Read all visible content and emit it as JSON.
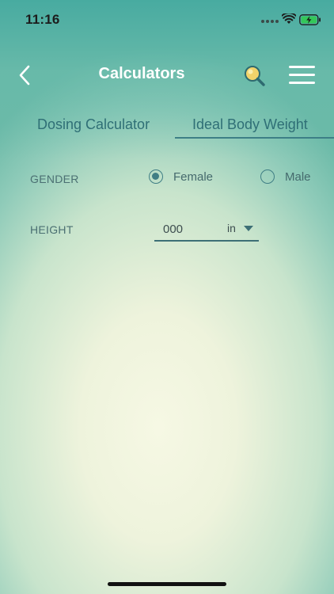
{
  "status_bar": {
    "time": "11:16"
  },
  "nav": {
    "title": "Calculators",
    "back_icon": "chevron-left-icon",
    "search_icon": "search-icon",
    "menu_icon": "hamburger-menu-icon"
  },
  "tabs": [
    {
      "label": "Dosing Calculator",
      "selected": false
    },
    {
      "label": "Ideal Body Weight",
      "selected": true
    }
  ],
  "form": {
    "gender": {
      "label": "GENDER",
      "options": [
        {
          "label": "Female",
          "selected": true
        },
        {
          "label": "Male",
          "selected": false
        }
      ]
    },
    "height": {
      "label": "HEIGHT",
      "value": "",
      "placeholder": "000",
      "unit": "in"
    }
  },
  "colors": {
    "accent": "#3f7e85",
    "tab_text": "#2f6f76",
    "label_text": "#4b6f72",
    "header_bg": "#46aaa0"
  }
}
